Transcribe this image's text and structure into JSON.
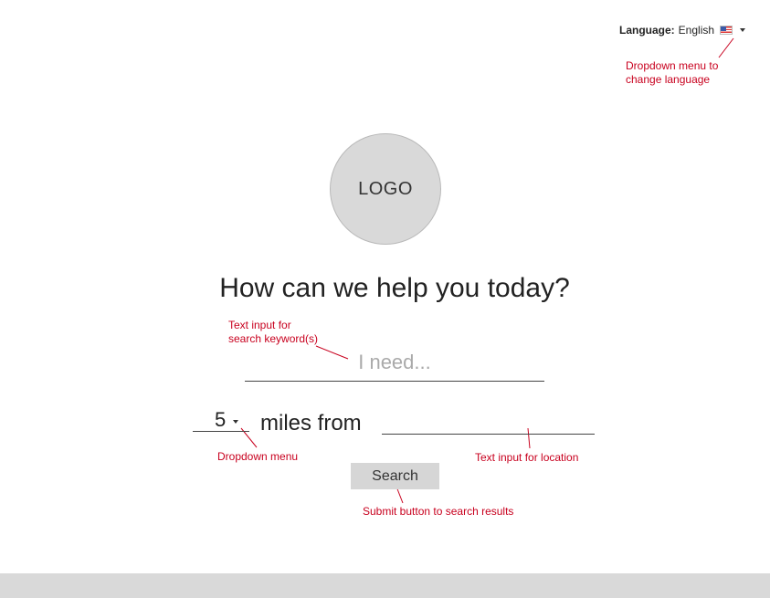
{
  "language_selector": {
    "label": "Language:",
    "value": "English",
    "flag_icon": "us-flag-icon"
  },
  "logo": {
    "text": "LOGO"
  },
  "headline": "How can we help you today?",
  "keyword_input": {
    "placeholder": "I need...",
    "value": ""
  },
  "radius_dropdown": {
    "value": "5"
  },
  "miles_label": "miles from",
  "location_input": {
    "value": ""
  },
  "search_button": {
    "label": "Search"
  },
  "annotations": {
    "language_line1": "Dropdown menu to",
    "language_line2": "change language",
    "keyword_line1": "Text input for",
    "keyword_line2": "search keyword(s)",
    "dropdown": "Dropdown menu",
    "location": "Text input for location",
    "submit": "Submit button to search results"
  },
  "colors": {
    "annotation": "#c8001e",
    "logo_fill": "#d9d9d9",
    "button_fill": "#d6d6d6",
    "footer_fill": "#d9d9d9"
  }
}
